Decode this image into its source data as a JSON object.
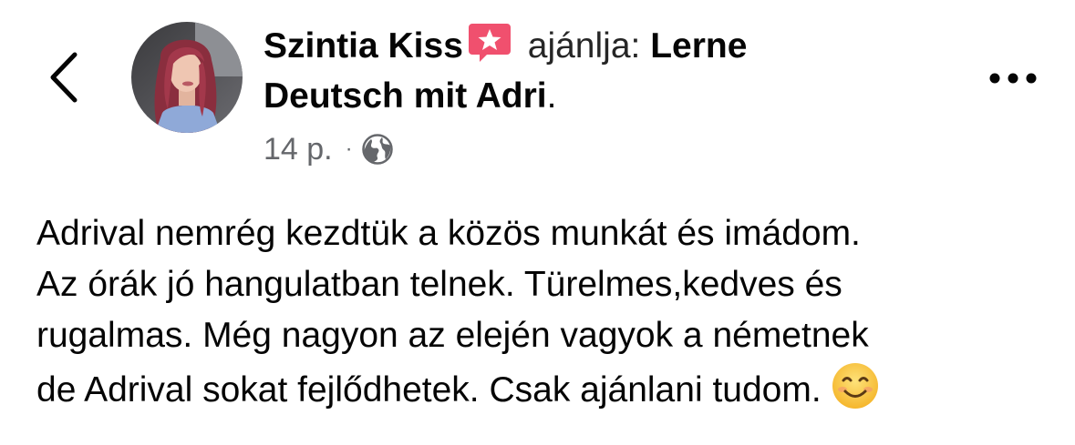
{
  "header": {
    "author_name": "Szintia Kiss",
    "recommends_label": "ajánlja:",
    "page_name": "Lerne Deutsch mit Adri",
    "page_name_line1": "Lerne",
    "page_name_line2": "Deutsch mit Adri",
    "trailing_period": ".",
    "time": "14 p.",
    "separator": "·",
    "privacy_icon": "globe-icon",
    "badge_icon": "star-badge-icon",
    "back_icon": "chevron-left-icon",
    "more_icon": "more-horizontal-icon"
  },
  "post": {
    "lines": [
      "Adrival nemrég kezdtük a közös munkát és imádom.",
      "Az órák jó hangulatban telnek. Türelmes,kedves és",
      "rugalmas. Még nagyon az elején vagyok a németnek",
      "de Adrival sokat fejlődhetek. Csak ajánlani tudom."
    ],
    "emoji": "smiling-face-emoji"
  },
  "colors": {
    "text": "#050505",
    "secondary_text": "#65676b",
    "badge_pink": "#f0506e",
    "emoji_yellow": "#f7c12e"
  }
}
